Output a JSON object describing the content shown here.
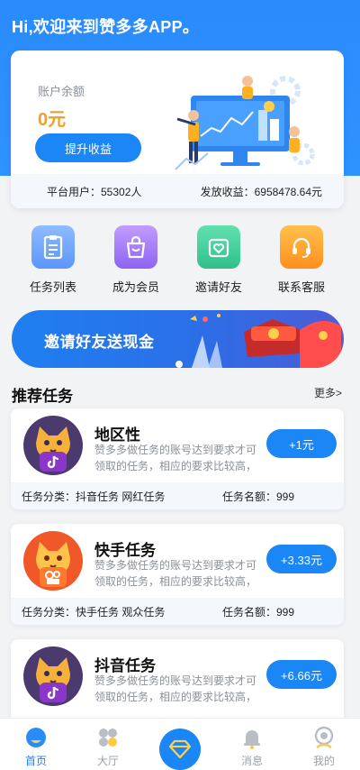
{
  "header": {
    "welcome": "Hi,欢迎来到赞多多APP。"
  },
  "balance": {
    "label": "账户余额",
    "amount": "0元",
    "boost_label": "提升收益",
    "platform_users": "平台用户：55302人",
    "payout": "发放收益：6958478.64元"
  },
  "quick_actions": [
    {
      "label": "任务列表",
      "icon": "task-list-icon",
      "color": "#6ea8fe"
    },
    {
      "label": "成为会员",
      "icon": "member-bag-icon",
      "color": "#a57cf7"
    },
    {
      "label": "邀请好友",
      "icon": "invite-heart-icon",
      "color": "#3fcf9a"
    },
    {
      "label": "联系客服",
      "icon": "headset-icon",
      "color": "#ffa024"
    }
  ],
  "banner": {
    "text": "邀请好友送现金"
  },
  "section": {
    "title": "推荐任务",
    "more": "更多>"
  },
  "tasks": [
    {
      "title": "地区性",
      "desc": "赞多多做任务的账号达到要求才可领取的任务，相应的要求比较高，",
      "reward": "+1元",
      "category": "任务分类：抖音任务 网红任务",
      "amount": "任务名额：999",
      "avatar": "douyin-cat",
      "avatar_bg": "#4a3a6e"
    },
    {
      "title": "快手任务",
      "desc": "赞多多做任务的账号达到要求才可领取的任务，相应的要求比较高，",
      "reward": "+3.33元",
      "category": "任务分类：快手任务 观众任务",
      "amount": "任务名额：999",
      "avatar": "kuaishou-cat",
      "avatar_bg": "#f0582a"
    },
    {
      "title": "抖音任务",
      "desc": "赞多多做任务的账号达到要求才可领取的任务，相应的要求比较高，",
      "reward": "+6.66元",
      "category": "",
      "amount": "",
      "avatar": "douyin-cat",
      "avatar_bg": "#4a3a6e"
    }
  ],
  "tabbar": [
    {
      "label": "首页",
      "icon": "home-icon",
      "active": true
    },
    {
      "label": "大厅",
      "icon": "hall-icon",
      "active": false
    },
    {
      "label": "",
      "icon": "diamond-icon",
      "active": false
    },
    {
      "label": "消息",
      "icon": "bell-icon",
      "active": false
    },
    {
      "label": "我的",
      "icon": "profile-icon",
      "active": false
    }
  ],
  "colors": {
    "primary": "#1b86f5",
    "amount": "#f0a028"
  }
}
